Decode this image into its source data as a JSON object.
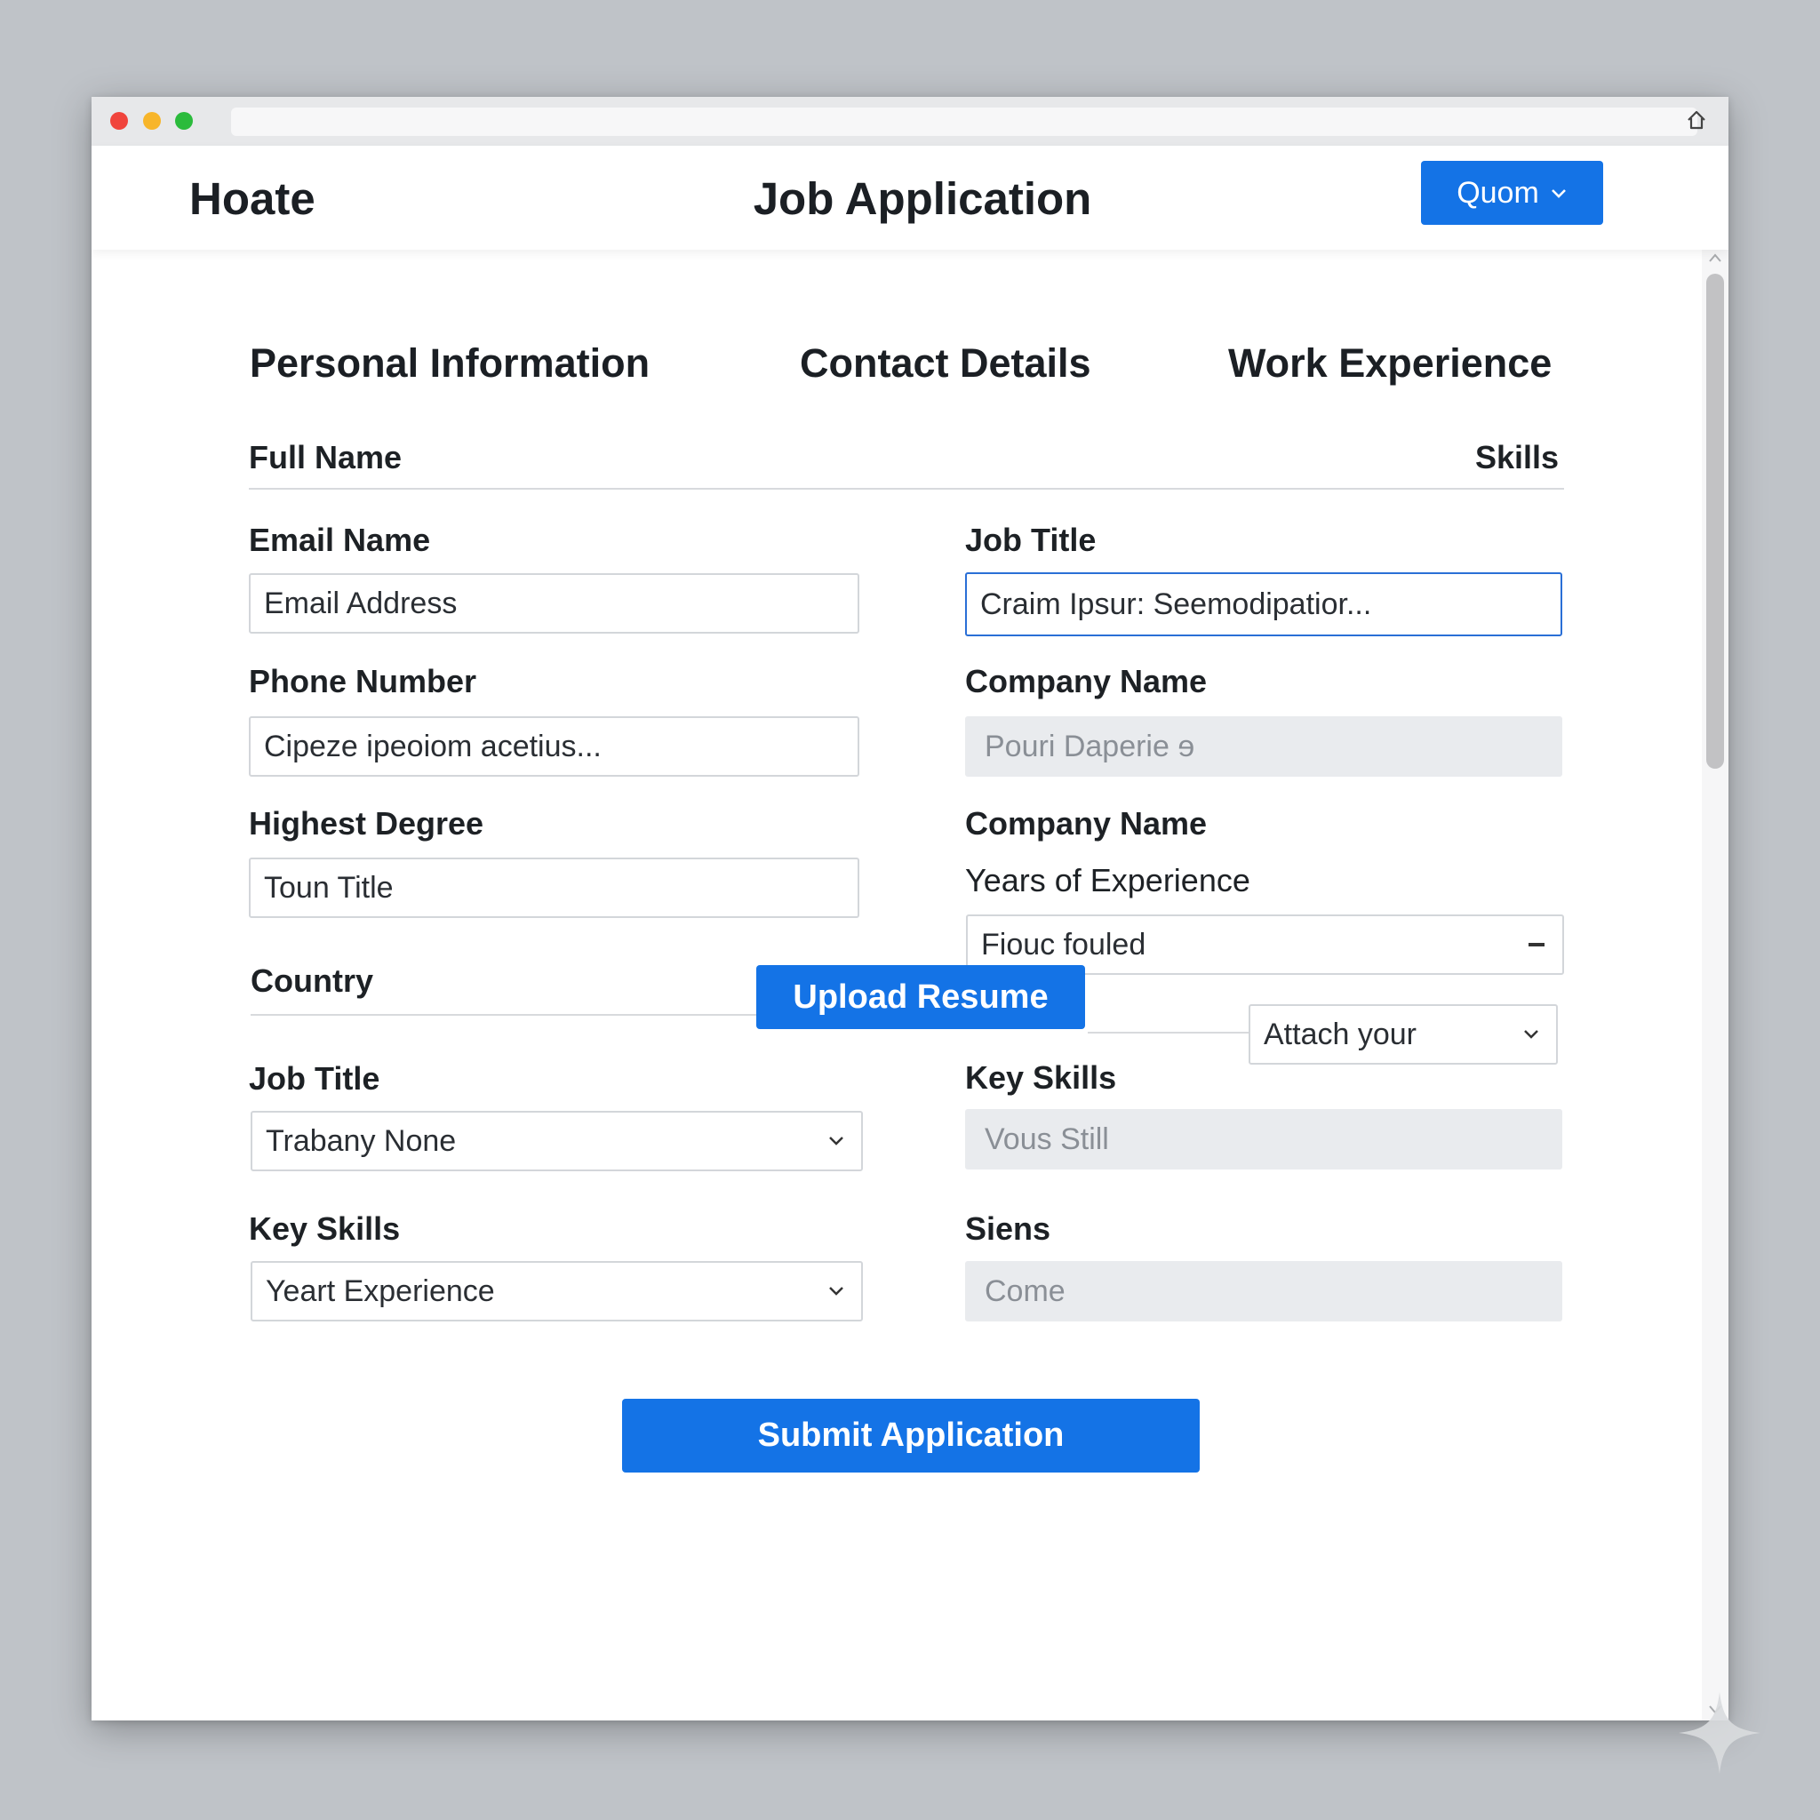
{
  "header": {
    "brand": "Hoate",
    "title": "Job Application",
    "account_button": "Quom"
  },
  "sections": {
    "personal": "Personal Information",
    "contact": "Contact Details",
    "work": "Work Experience"
  },
  "form": {
    "full_name_label": "Full Name",
    "skills_label": "Skills",
    "email_label": "Email Name",
    "email_value": "Email Address",
    "phone_label": "Phone Number",
    "phone_value": "Cipeze ipeoiom acetius...",
    "degree_label": "Highest Degree",
    "degree_value": "Toun Title",
    "country_label": "Country",
    "left_job_title_label": "Job Title",
    "left_job_title_value": "Trabany None",
    "left_key_skills_label": "Key Skills",
    "left_key_skills_value": "Yeart Experience",
    "right_job_title_label": "Job Title",
    "right_job_title_value": "Craim Ipsur: Seemodipatior...",
    "company_label_1": "Company Name",
    "company_value": "Pouri Daperie  ɘ",
    "company_label_2": "Company Name",
    "years_label": "Years of Experience",
    "years_value": "Fiouc fouled",
    "attach_value": "Attach your",
    "right_key_skills_label": "Key Skills",
    "right_key_skills_value": "Vous Still",
    "siens_label": "Siens",
    "siens_value": "Come"
  },
  "buttons": {
    "upload": "Upload Resume",
    "submit": "Submit Application"
  },
  "colors": {
    "accent": "#1473e6",
    "focus_border": "#2a6fd6",
    "filled_field": "#e9ebee"
  }
}
